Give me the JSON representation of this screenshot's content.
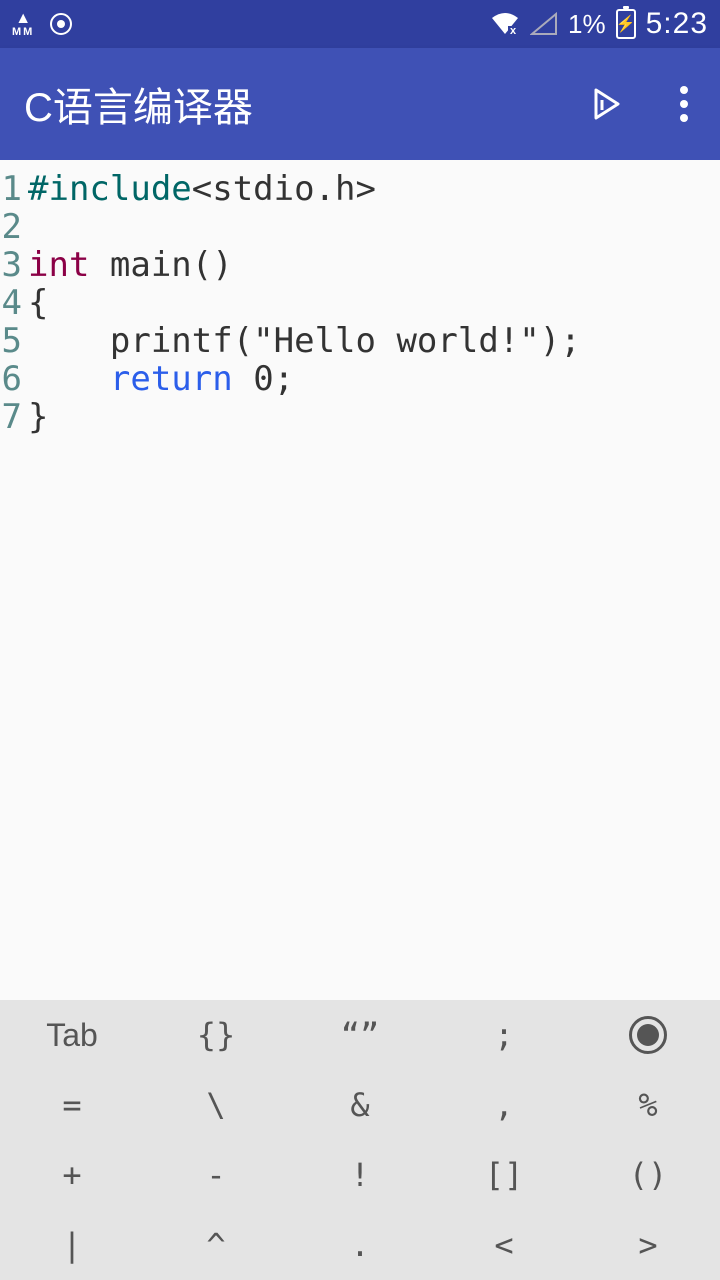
{
  "status": {
    "mm_label": "MM",
    "battery_pct": "1%",
    "time": "5:23"
  },
  "app_bar": {
    "title": "C语言编译器"
  },
  "editor": {
    "lines": [
      {
        "n": "1",
        "tokens": [
          [
            "preproc",
            "#include"
          ],
          [
            "text",
            "<stdio.h>"
          ]
        ]
      },
      {
        "n": "2",
        "tokens": []
      },
      {
        "n": "3",
        "tokens": [
          [
            "keyword",
            "int"
          ],
          [
            "text",
            " main()"
          ]
        ]
      },
      {
        "n": "4",
        "tokens": [
          [
            "text",
            "{"
          ]
        ]
      },
      {
        "n": "5",
        "tokens": [
          [
            "text",
            "    printf(\"Hello world!\");"
          ]
        ]
      },
      {
        "n": "6",
        "tokens": [
          [
            "text",
            "    "
          ],
          [
            "return",
            "return"
          ],
          [
            "text",
            " 0;"
          ]
        ]
      },
      {
        "n": "7",
        "tokens": [
          [
            "text",
            "}"
          ]
        ]
      }
    ]
  },
  "keyboard": {
    "rows": [
      [
        "Tab",
        "{}",
        "“”",
        ";",
        "●"
      ],
      [
        "=",
        "\\",
        "&",
        ",",
        "%"
      ],
      [
        "+",
        "-",
        "!",
        "[]",
        "()"
      ],
      [
        "|",
        "^",
        ".",
        "<",
        ">"
      ]
    ]
  }
}
